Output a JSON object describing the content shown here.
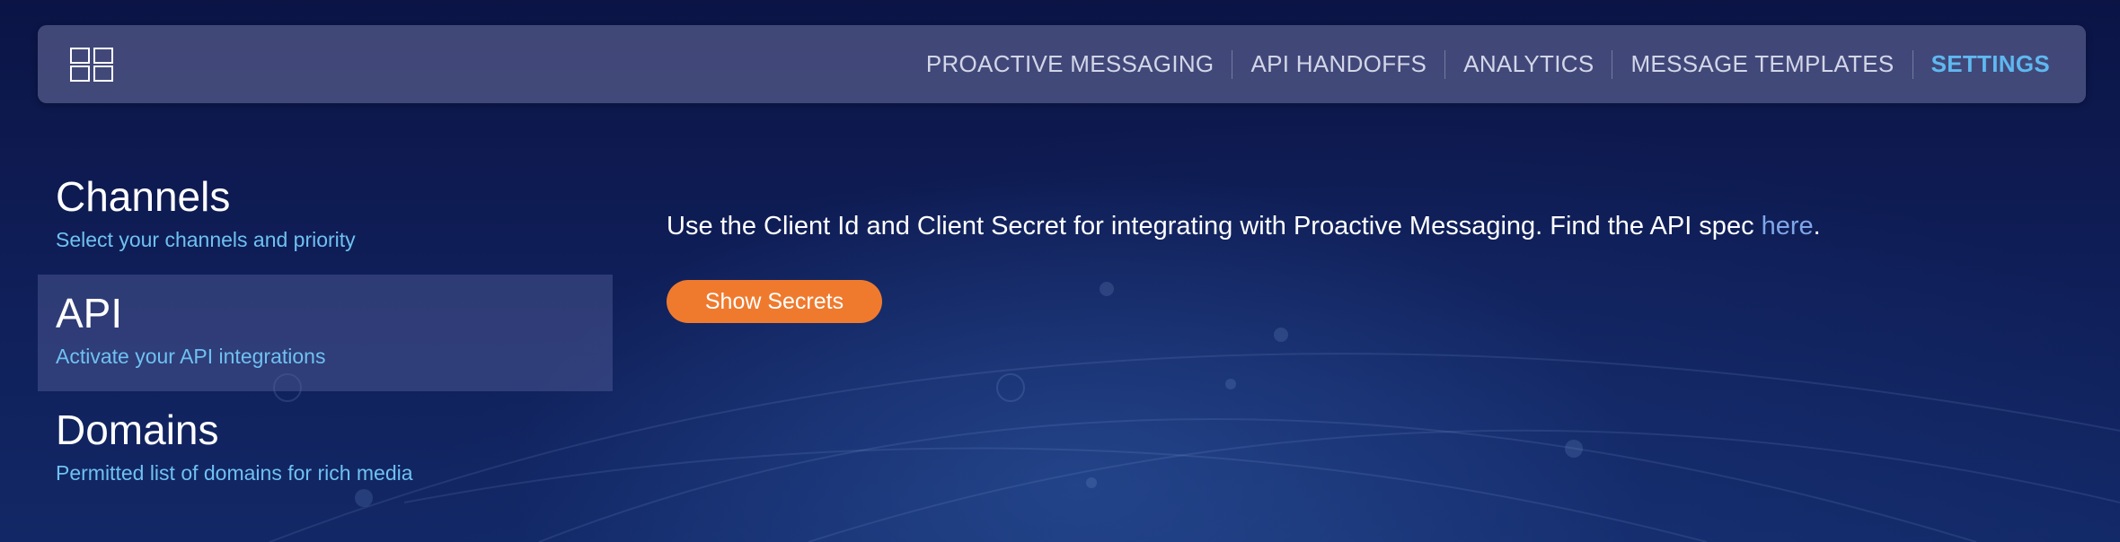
{
  "header": {
    "app_icon": "grid-layout-icon",
    "nav": [
      {
        "label": "PROACTIVE MESSAGING",
        "active": false
      },
      {
        "label": "API HANDOFFS",
        "active": false
      },
      {
        "label": "ANALYTICS",
        "active": false
      },
      {
        "label": "MESSAGE TEMPLATES",
        "active": false
      },
      {
        "label": "SETTINGS",
        "active": true
      }
    ]
  },
  "sidebar": {
    "items": [
      {
        "title": "Channels",
        "subtitle": "Select your channels and priority",
        "selected": false
      },
      {
        "title": "API",
        "subtitle": "Activate your API integrations",
        "selected": true
      },
      {
        "title": "Domains",
        "subtitle": "Permitted list of domains for rich media",
        "selected": false
      }
    ]
  },
  "main": {
    "description": "Use the Client Id and Client Secret for integrating with Proactive Messaging. Find the API spec ",
    "link_text": "here",
    "description_end": ".",
    "show_secrets_label": "Show Secrets"
  },
  "colors": {
    "accent": "#5fb8f0",
    "subtitle": "#6fc1f2",
    "button": "#ef7a2e",
    "link": "#7fa7e8",
    "background": "#0f1d56"
  }
}
